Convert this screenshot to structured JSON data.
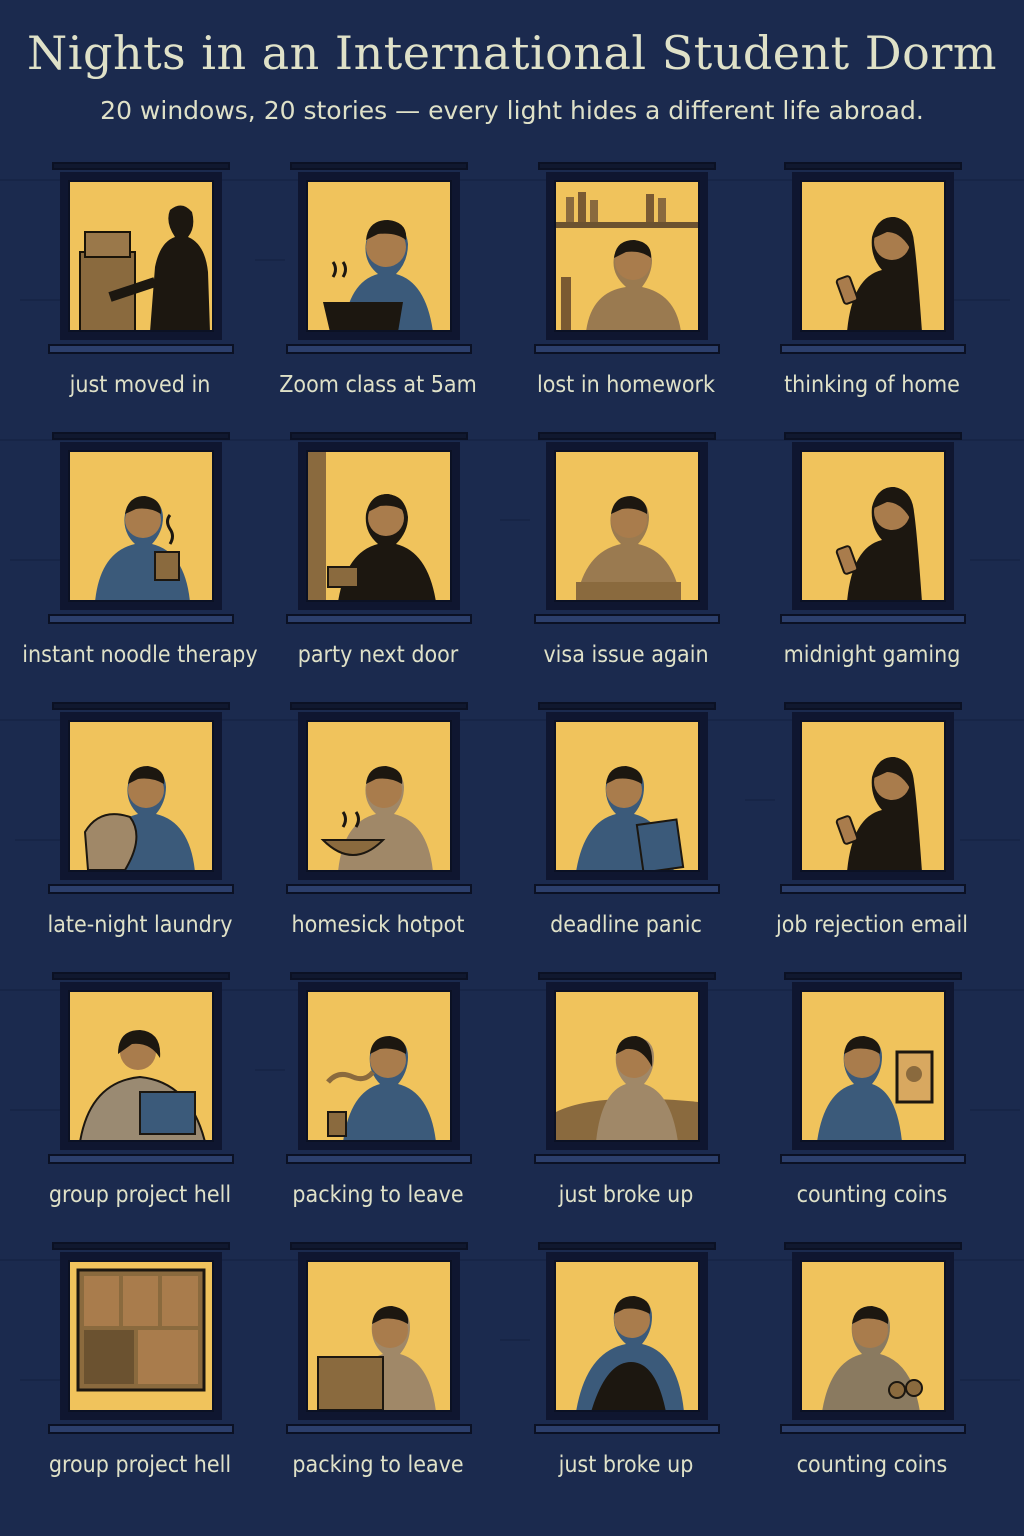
{
  "header": {
    "title": "Nights in an International Student Dorm",
    "subtitle": "20 windows, 20 stories — every light hides a different life abroad."
  },
  "colors": {
    "background": "#1b2a4e",
    "window_light": "#f0c35c",
    "text": "#dfe1c8"
  },
  "windows": [
    {
      "label": "just moved in",
      "icon": "moving-boxes-scene"
    },
    {
      "label": "Zoom class at 5am",
      "icon": "laptop-scene"
    },
    {
      "label": "lost in homework",
      "icon": "bookshelf-scene"
    },
    {
      "label": "thinking of home",
      "icon": "phone-scene"
    },
    {
      "label": "instant noodle therapy",
      "icon": "mug-scene"
    },
    {
      "label": "party next door",
      "icon": "ear-covering-scene"
    },
    {
      "label": "visa issue again",
      "icon": "head-in-hand-scene"
    },
    {
      "label": "midnight gaming",
      "icon": "phone-scene"
    },
    {
      "label": "late-night laundry",
      "icon": "laundry-scene"
    },
    {
      "label": "homesick hotpot",
      "icon": "hotpot-scene"
    },
    {
      "label": "deadline panic",
      "icon": "book-scene"
    },
    {
      "label": "job rejection email",
      "icon": "phone-scene"
    },
    {
      "label": "group project hell",
      "icon": "blanket-laptop-scene"
    },
    {
      "label": "packing to leave",
      "icon": "sigh-scene"
    },
    {
      "label": "just broke up",
      "icon": "reading-bed-scene"
    },
    {
      "label": "counting coins",
      "icon": "photo-frame-scene"
    },
    {
      "label": "group project hell",
      "icon": "video-call-scene"
    },
    {
      "label": "packing to leave",
      "icon": "suitcase-scene"
    },
    {
      "label": "just broke up",
      "icon": "knees-hug-scene"
    },
    {
      "label": "counting coins",
      "icon": "coins-scene"
    }
  ]
}
